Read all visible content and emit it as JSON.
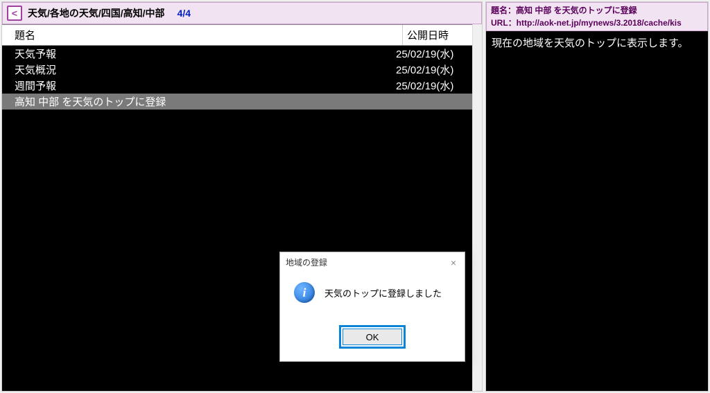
{
  "breadcrumb": {
    "path": "天気/各地の天気/四国/高知/中部",
    "counter": "4/4"
  },
  "table": {
    "headers": {
      "title": "題名",
      "date": "公開日時"
    },
    "rows": [
      {
        "title": "天気予報",
        "date": "25/02/19(水)",
        "selected": false
      },
      {
        "title": "天気概況",
        "date": "25/02/19(水)",
        "selected": false
      },
      {
        "title": "週間予報",
        "date": "25/02/19(水)",
        "selected": false
      },
      {
        "title": "高知 中部 を天気のトップに登録",
        "date": "",
        "selected": true
      }
    ]
  },
  "detail": {
    "title_label": "題名：",
    "title_value": "高知 中部 を天気のトップに登録",
    "url_label": "URL：",
    "url_value": "http://aok-net.jp/mynews/3.2018/cache/kis",
    "body": "現在の地域を天気のトップに表示します。"
  },
  "dialog": {
    "title": "地域の登録",
    "message": "天気のトップに登録しました",
    "ok": "OK",
    "info_glyph": "i",
    "close_glyph": "×"
  },
  "icons": {
    "back": "<"
  }
}
